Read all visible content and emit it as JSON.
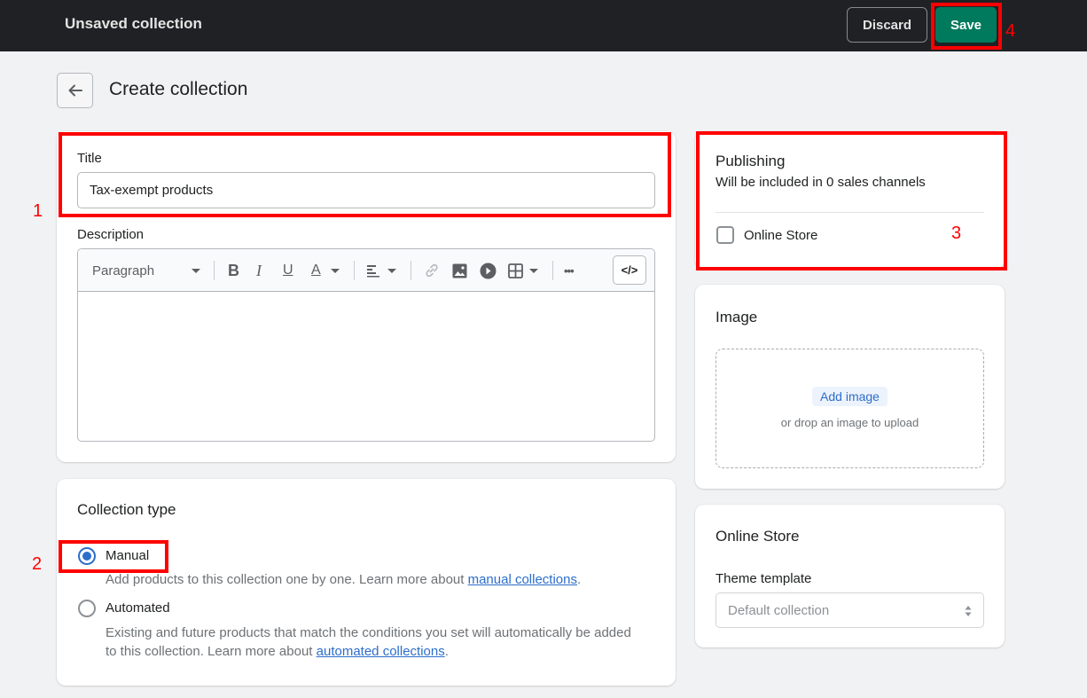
{
  "topbar": {
    "title": "Unsaved collection",
    "discard_label": "Discard",
    "save_label": "Save",
    "save_color": "#007a5c"
  },
  "header": {
    "back_icon": "arrow-left-icon",
    "title": "Create collection"
  },
  "details": {
    "title_label": "Title",
    "title_value": "Tax-exempt products",
    "description_label": "Description",
    "toolbar": {
      "format_select": "Paragraph",
      "buttons": [
        "bold",
        "italic",
        "underline",
        "text-color",
        "align",
        "link",
        "image",
        "video",
        "table",
        "more",
        "show-html"
      ],
      "bold_glyph": "B",
      "italic_glyph": "I",
      "underline_glyph": "U",
      "color_glyph": "A",
      "more_glyph": "•••",
      "code_glyph": "</>"
    },
    "description_value": ""
  },
  "collection_type": {
    "heading": "Collection type",
    "options": [
      {
        "label": "Manual",
        "selected": true,
        "help_prefix": "Add products to this collection one by one. Learn more about ",
        "link": "manual collections",
        "help_suffix": "."
      },
      {
        "label": "Automated",
        "selected": false,
        "help_prefix": "Existing and future products that match the conditions you set will automatically be added to this collection. Learn more about ",
        "link": "automated collections",
        "help_suffix": "."
      }
    ]
  },
  "publishing": {
    "heading": "Publishing",
    "subtitle": "Will be included in 0 sales channels",
    "channels": [
      {
        "label": "Online Store",
        "checked": false
      }
    ]
  },
  "image": {
    "heading": "Image",
    "add_label": "Add image",
    "hint": "or drop an image to upload"
  },
  "online_store": {
    "heading": "Online Store",
    "template_label": "Theme template",
    "template_value": "Default collection"
  },
  "annotations": {
    "color": "#ff0000",
    "labels": [
      "1",
      "2",
      "3",
      "4"
    ]
  }
}
